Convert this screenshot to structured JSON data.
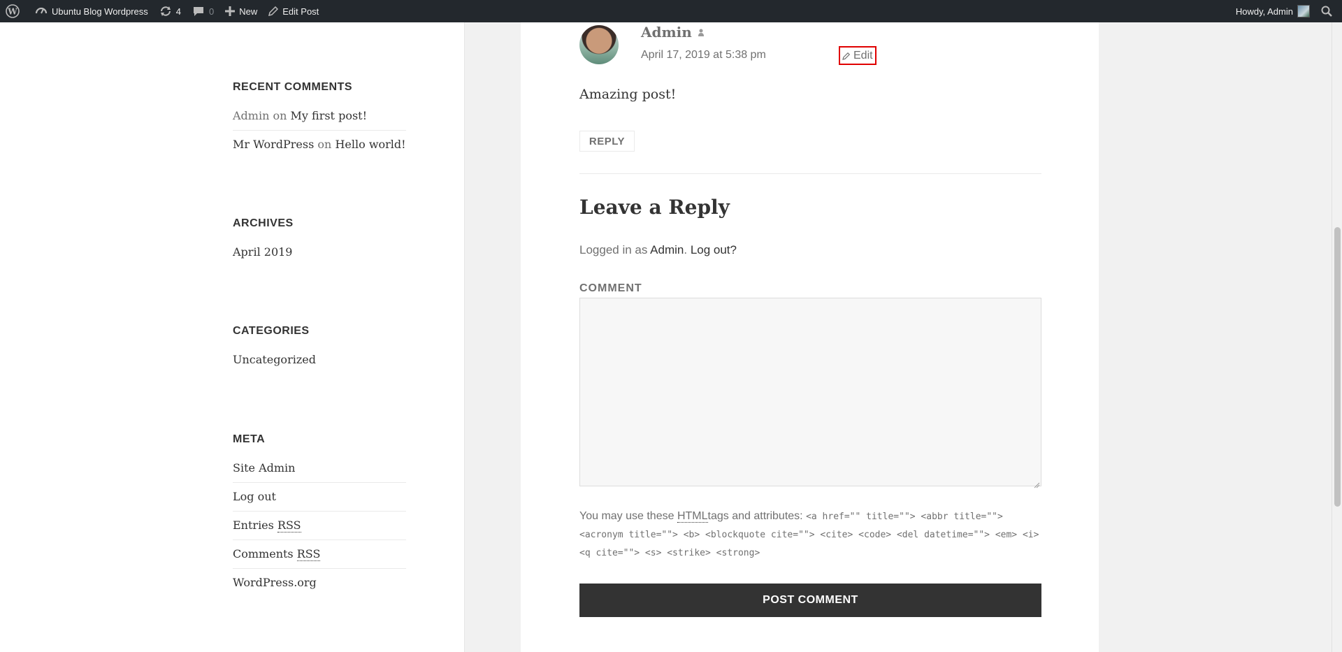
{
  "adminbar": {
    "site_name": "Ubuntu Blog Wordpress",
    "updates_count": "4",
    "comments_count": "0",
    "new_label": "New",
    "edit_post_label": "Edit Post",
    "howdy": "Howdy, Admin"
  },
  "sidebar": {
    "recent_comments": {
      "title": "RECENT COMMENTS",
      "items": [
        {
          "author": "Admin",
          "on": "on",
          "post": "My first post!"
        },
        {
          "author": "Mr WordPress",
          "on": "on",
          "post": "Hello world!"
        }
      ]
    },
    "archives": {
      "title": "ARCHIVES",
      "items": [
        "April 2019"
      ]
    },
    "categories": {
      "title": "CATEGORIES",
      "items": [
        "Uncategorized"
      ]
    },
    "meta": {
      "title": "META",
      "items": [
        "Site Admin",
        "Log out",
        "Entries",
        "Comments",
        "WordPress.org"
      ],
      "rss": "RSS"
    }
  },
  "comment": {
    "author": "Admin",
    "date": "April 17, 2019 at 5:38 pm",
    "edit_label": "Edit",
    "body": "Amazing post!",
    "reply_label": "REPLY"
  },
  "reply_form": {
    "title": "Leave a Reply",
    "logged_in_prefix": "Logged in as",
    "logged_in_user": "Admin",
    "logout_label": "Log out?",
    "comment_label": "COMMENT",
    "comment_value": "",
    "allowed_prefix": "You may use these",
    "html_abbr": "HTML",
    "allowed_suffix": "tags and attributes:",
    "allowed_tags": "<a href=\"\" title=\"\"> <abbr title=\"\"> <acronym title=\"\"> <b> <blockquote cite=\"\"> <cite> <code> <del datetime=\"\"> <em> <i> <q cite=\"\"> <s> <strike> <strong>",
    "submit_label": "POST COMMENT"
  },
  "colors": {
    "adminbar_bg": "#23282d",
    "button_dark": "#333333",
    "highlight_red": "#e00000"
  }
}
